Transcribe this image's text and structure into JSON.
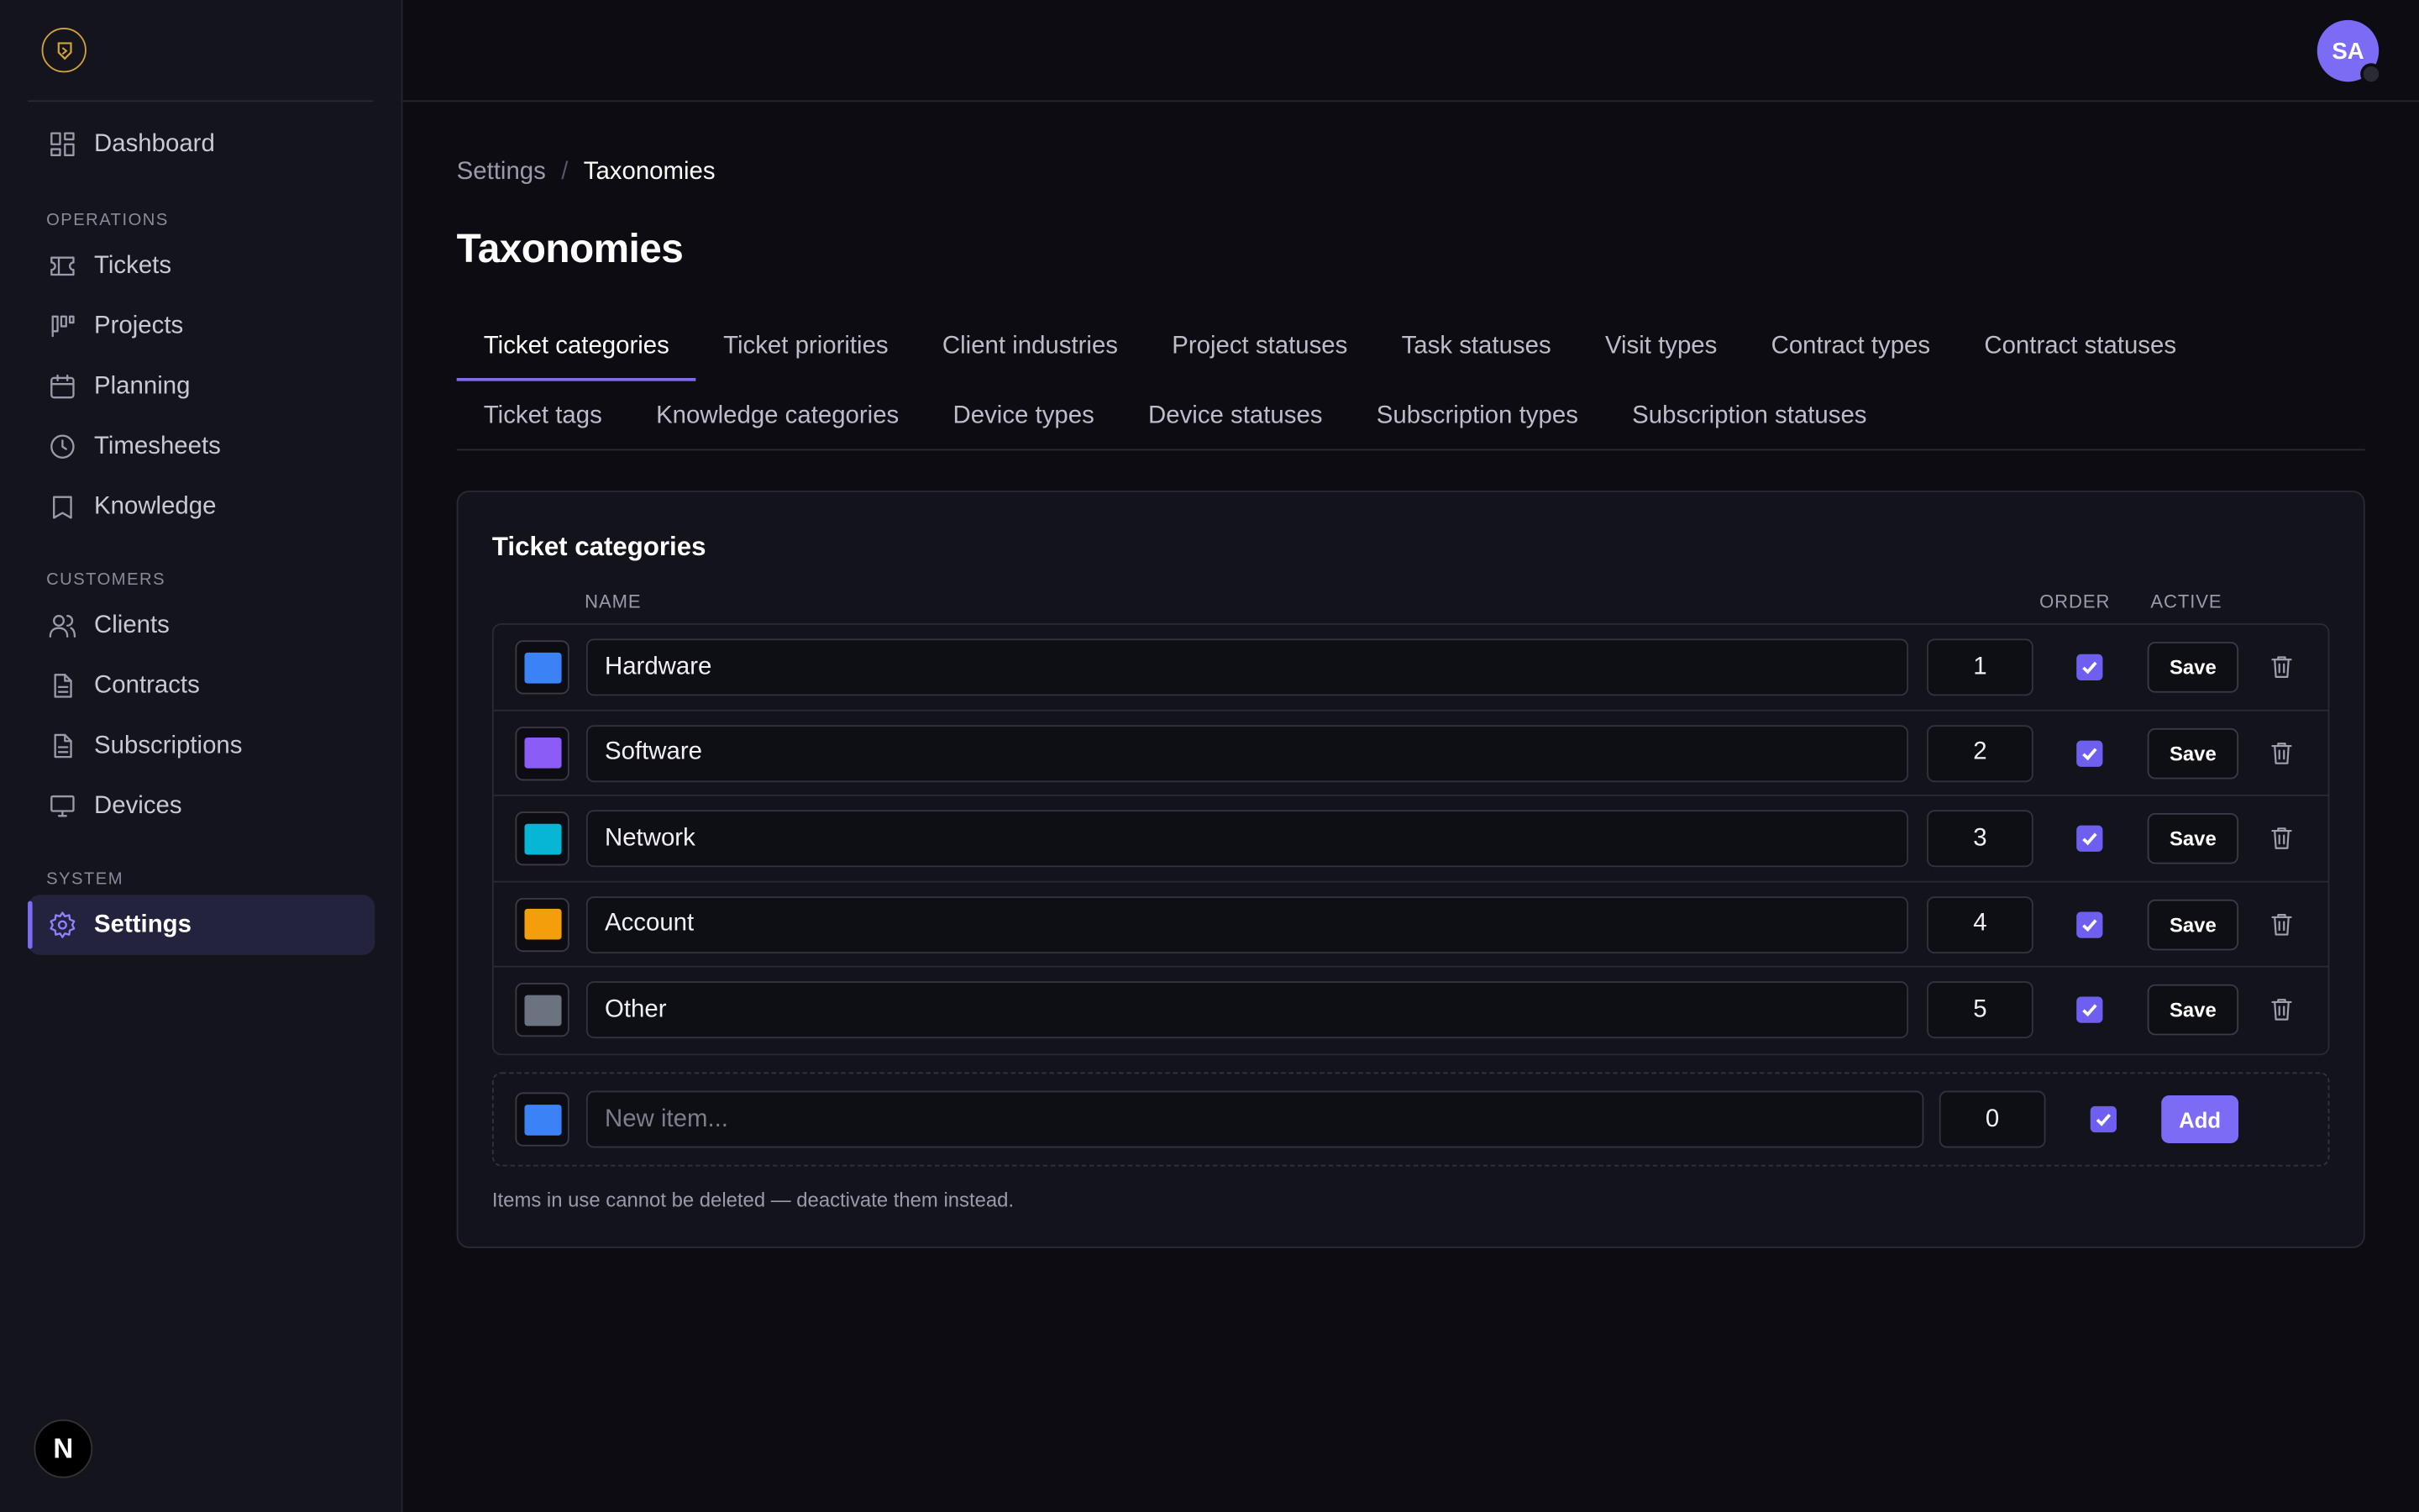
{
  "sidebar": {
    "items": [
      {
        "label": "Dashboard",
        "icon": "dashboard-icon"
      },
      {
        "section": "OPERATIONS"
      },
      {
        "label": "Tickets",
        "icon": "ticket-icon"
      },
      {
        "label": "Projects",
        "icon": "kanban-icon"
      },
      {
        "label": "Planning",
        "icon": "calendar-icon"
      },
      {
        "label": "Timesheets",
        "icon": "clock-icon"
      },
      {
        "label": "Knowledge",
        "icon": "book-icon"
      },
      {
        "section": "CUSTOMERS"
      },
      {
        "label": "Clients",
        "icon": "users-icon"
      },
      {
        "label": "Contracts",
        "icon": "document-icon"
      },
      {
        "label": "Subscriptions",
        "icon": "document-icon"
      },
      {
        "label": "Devices",
        "icon": "monitor-icon"
      },
      {
        "section": "SYSTEM"
      },
      {
        "label": "Settings",
        "icon": "gear-icon",
        "active": true
      }
    ],
    "badge": "N"
  },
  "topbar": {
    "avatar_initials": "SA"
  },
  "breadcrumb": {
    "parent": "Settings",
    "separator": "/",
    "current": "Taxonomies"
  },
  "page_title": "Taxonomies",
  "tabs_row1": [
    "Ticket categories",
    "Ticket priorities",
    "Client industries",
    "Project statuses",
    "Task statuses",
    "Visit types",
    "Contract types",
    "Contract statuses"
  ],
  "tabs_row2": [
    "Ticket tags",
    "Knowledge categories",
    "Device types",
    "Device statuses",
    "Subscription types",
    "Subscription statuses"
  ],
  "active_tab": "Ticket categories",
  "card": {
    "title": "Ticket categories",
    "columns": {
      "name": "NAME",
      "order": "ORDER",
      "active": "ACTIVE"
    },
    "rows": [
      {
        "name": "Hardware",
        "order": "1",
        "color": "#3b82f6",
        "active": true,
        "save": "Save"
      },
      {
        "name": "Software",
        "order": "2",
        "color": "#8b5cf6",
        "active": true,
        "save": "Save"
      },
      {
        "name": "Network",
        "order": "3",
        "color": "#06b6d4",
        "active": true,
        "save": "Save"
      },
      {
        "name": "Account",
        "order": "4",
        "color": "#f59e0b",
        "active": true,
        "save": "Save"
      },
      {
        "name": "Other",
        "order": "5",
        "color": "#6b7280",
        "active": true,
        "save": "Save"
      }
    ],
    "new_item": {
      "placeholder": "New item...",
      "order": "0",
      "color": "#3b82f6",
      "active": true,
      "add": "Add"
    },
    "hint": "Items in use cannot be deleted — deactivate them instead."
  },
  "colors": {
    "accent": "#7c6cf5",
    "background": "#0c0c12",
    "sidebar": "#14141c"
  }
}
